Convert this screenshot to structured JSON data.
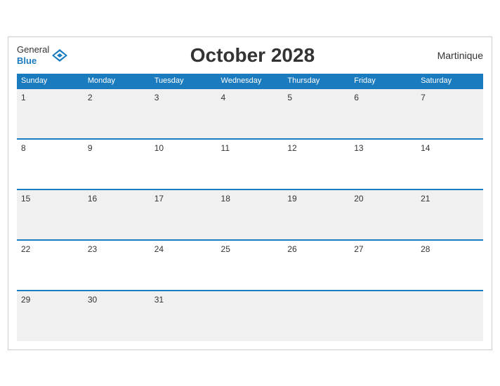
{
  "header": {
    "logo_general": "General",
    "logo_blue": "Blue",
    "title": "October 2028",
    "location": "Martinique"
  },
  "weekdays": [
    "Sunday",
    "Monday",
    "Tuesday",
    "Wednesday",
    "Thursday",
    "Friday",
    "Saturday"
  ],
  "weeks": [
    [
      1,
      2,
      3,
      4,
      5,
      6,
      7
    ],
    [
      8,
      9,
      10,
      11,
      12,
      13,
      14
    ],
    [
      15,
      16,
      17,
      18,
      19,
      20,
      21
    ],
    [
      22,
      23,
      24,
      25,
      26,
      27,
      28
    ],
    [
      29,
      30,
      31,
      null,
      null,
      null,
      null
    ]
  ]
}
